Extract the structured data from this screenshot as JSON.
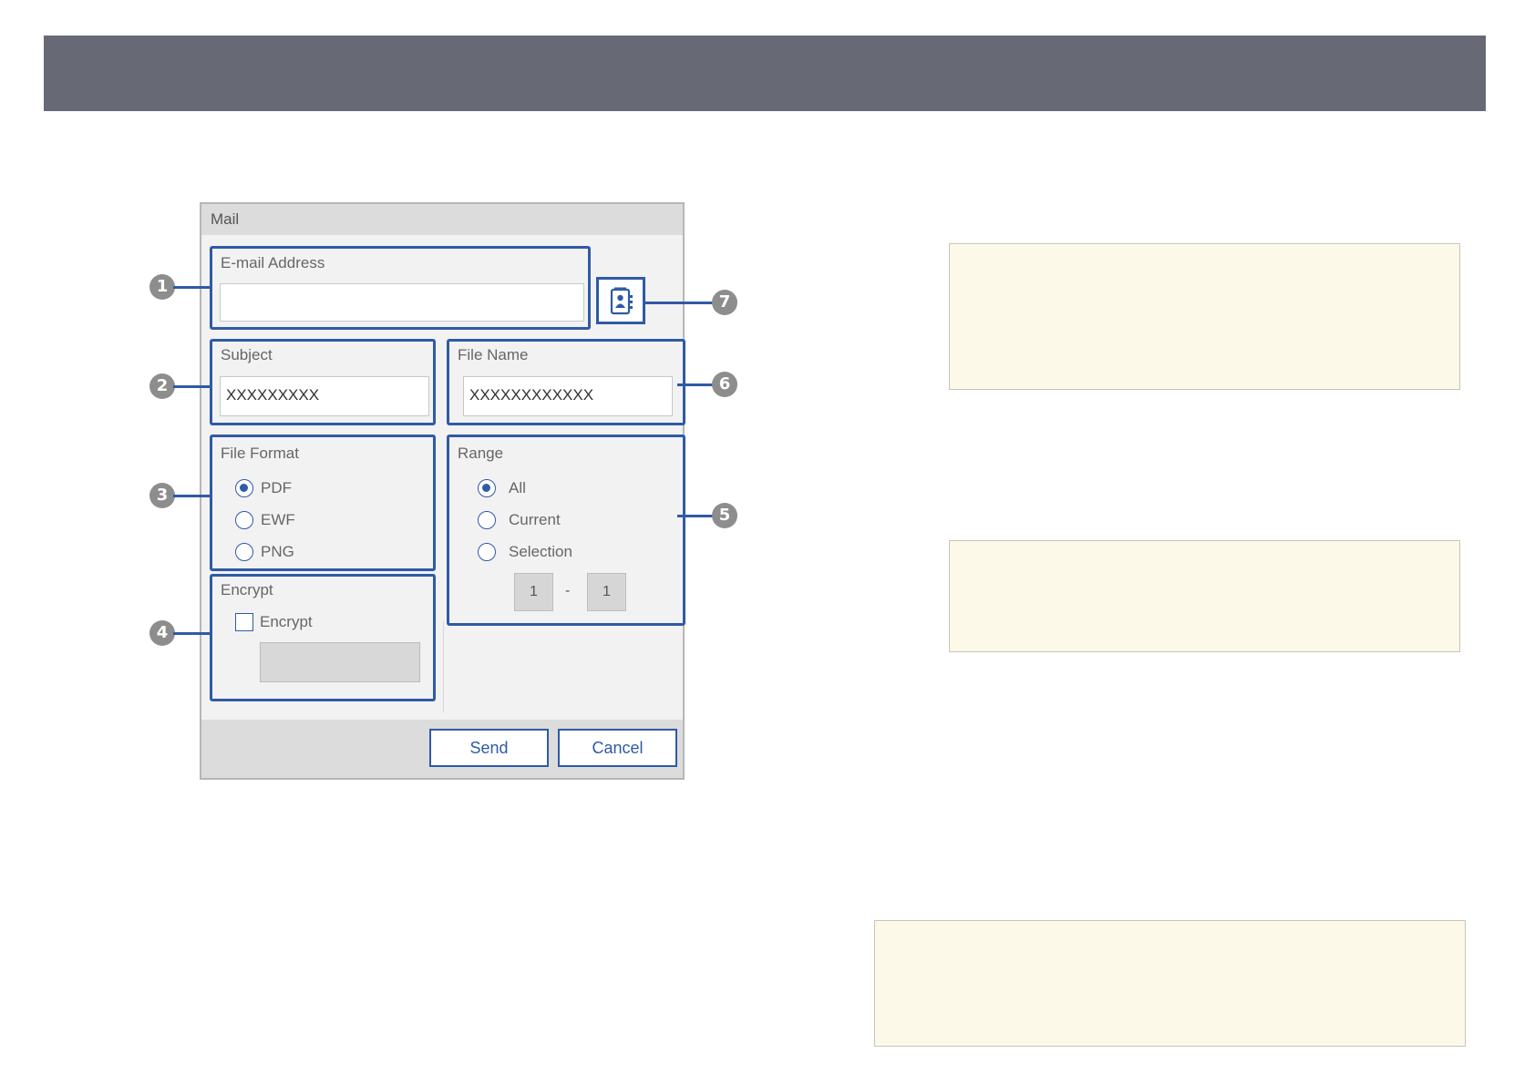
{
  "dialog": {
    "title": "Mail",
    "email": {
      "label": "E-mail Address",
      "value": ""
    },
    "subject": {
      "label": "Subject",
      "value": "XXXXXXXXX"
    },
    "file_name": {
      "label": "File Name",
      "value": "XXXXXXXXXXXX"
    },
    "file_format": {
      "label": "File Format",
      "options": [
        {
          "label": "PDF",
          "checked": true
        },
        {
          "label": "EWF",
          "checked": false
        },
        {
          "label": "PNG",
          "checked": false
        }
      ]
    },
    "range": {
      "label": "Range",
      "options": [
        {
          "label": "All",
          "checked": true
        },
        {
          "label": "Current",
          "checked": false
        },
        {
          "label": "Selection",
          "checked": false
        }
      ],
      "from": "1",
      "separator": "-",
      "to": "1"
    },
    "encrypt": {
      "label": "Encrypt",
      "checkbox_label": "Encrypt",
      "checked": false
    },
    "buttons": {
      "send": "Send",
      "cancel": "Cancel"
    },
    "address_book_icon": "address-book-icon"
  },
  "callouts": [
    "1",
    "2",
    "3",
    "4",
    "5",
    "6",
    "7"
  ],
  "colors": {
    "accent": "#2f5aa6",
    "header_bar": "#676a74",
    "note_bg": "#fdf9e9",
    "callout": "#8d8d8d"
  }
}
